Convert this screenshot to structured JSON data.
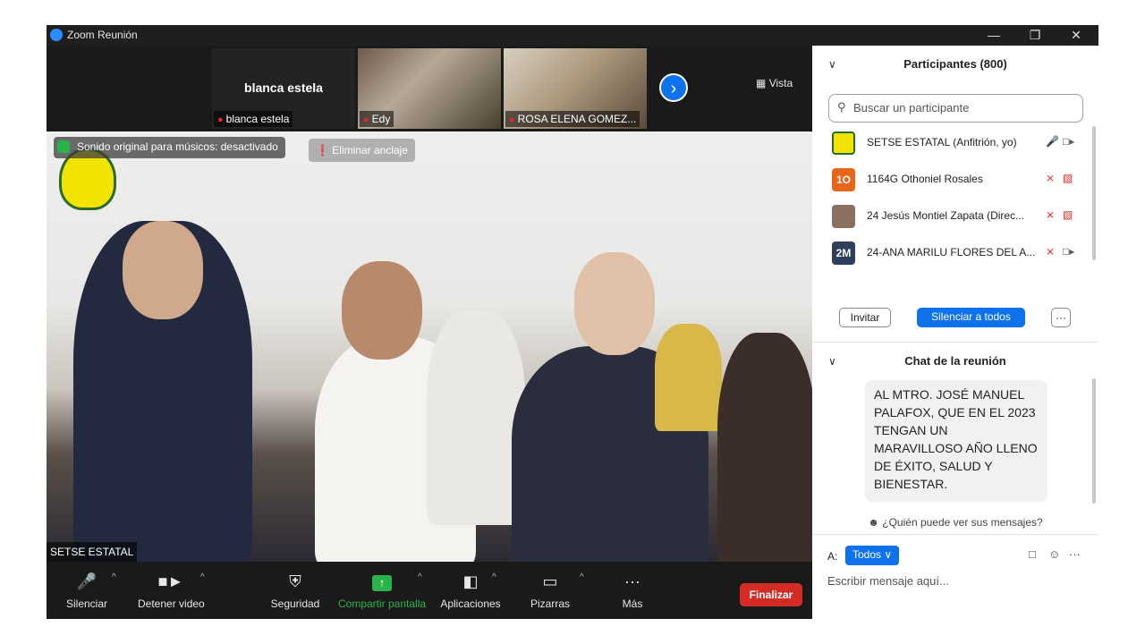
{
  "window": {
    "title": "Zoom Reunión",
    "minimize": "—",
    "restore": "❐",
    "close": "✕"
  },
  "gallery": {
    "tiles": [
      {
        "big_name": "blanca estela",
        "name": "blanca estela"
      },
      {
        "name": "Edy"
      },
      {
        "name": "ROSA ELENA GOMEZ..."
      }
    ],
    "next_icon": "›",
    "view_label": "Vista"
  },
  "main_video": {
    "original_sound": "Sonido original para músicos: desactivado",
    "unpin": "Eliminar anclaje",
    "name": "SETSE ESTATAL"
  },
  "toolbar": {
    "mute": "Silenciar",
    "stop_video": "Detener video",
    "security": "Seguridad",
    "share": "Compartir pantalla",
    "apps": "Aplicaciones",
    "whiteboards": "Pizarras",
    "more": "Más",
    "end": "Finalizar",
    "caret": "^"
  },
  "participants": {
    "header": "Participantes (800)",
    "search_placeholder": "Buscar un participante",
    "list": [
      {
        "name": "SETSE ESTATAL (Anfitrión, yo)",
        "avatar": "",
        "avatar_color": "#f2e300"
      },
      {
        "name": "1164G Othoniel Rosales",
        "avatar": "1O",
        "avatar_color": "#e8641a"
      },
      {
        "name": "24 Jesús Montiel Zapata (Direc...",
        "avatar": "",
        "avatar_color": "#8a7060"
      },
      {
        "name": "24-ANA MARILU FLORES DEL A...",
        "avatar": "2M",
        "avatar_color": "#2d3f5a"
      }
    ],
    "invite": "Invitar",
    "mute_all": "Silenciar a todos",
    "more": "···"
  },
  "chat": {
    "header": "Chat de la reunión",
    "message": "AL MTRO. JOSÉ MANUEL PALAFOX, QUE EN EL 2023 TENGAN UN MARAVILLOSO AÑO LLENO DE ÉXITO, SALUD Y BIENESTAR.",
    "who_can_see": "¿Quién puede ver sus mensajes?",
    "to_label": "A:",
    "to_value": "Todos",
    "input_placeholder": "Escribir mensaje aquí..."
  }
}
